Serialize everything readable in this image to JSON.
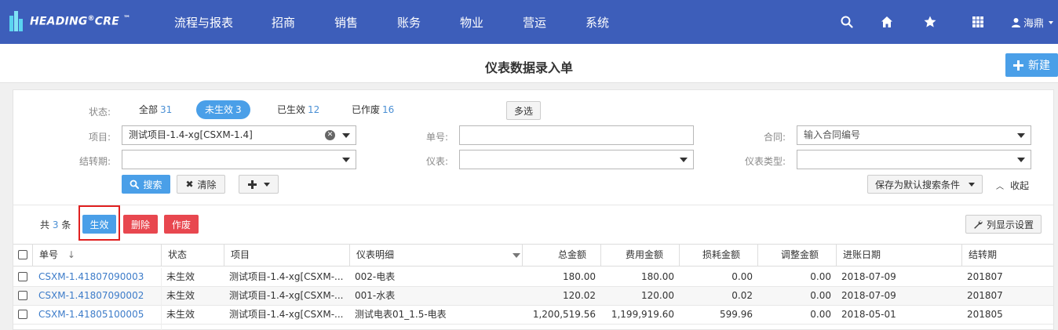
{
  "header": {
    "logo_text": "HEADING",
    "logo_reg": "®",
    "logo_text2": "CRE",
    "logo_tm": "™",
    "nav": [
      "流程与报表",
      "招商",
      "销售",
      "账务",
      "物业",
      "营运",
      "系统"
    ],
    "icons": [
      "search-icon",
      "home-icon",
      "star-icon",
      "grid-icon"
    ],
    "user_name": "海鼎"
  },
  "title_bar": {
    "title": "仪表数据录入单",
    "new_label": "新建"
  },
  "filters": {
    "status_label": "状态:",
    "status_tabs": [
      {
        "label": "全部",
        "count": "31"
      },
      {
        "label": "未生效",
        "count": "3"
      },
      {
        "label": "已生效",
        "count": "12"
      },
      {
        "label": "已作废",
        "count": "16"
      }
    ],
    "multi_select_label": "多选",
    "project_label": "项目:",
    "project_value": "测试项目-1.4-xg[CSXM-1.4]",
    "bill_no_label": "单号:",
    "bill_no_value": "",
    "contract_label": "合同:",
    "contract_placeholder": "输入合同编号",
    "period_label": "结转期:",
    "period_value": "",
    "meter_label": "仪表:",
    "meter_value": "",
    "meter_type_label": "仪表类型:",
    "meter_type_value": "",
    "search_label": "搜索",
    "clear_label": "清除",
    "save_default_label": "保存为默认搜索条件",
    "collapse_label": "收起"
  },
  "actions": {
    "total_prefix": "共",
    "total_count": "3",
    "total_suffix": "条",
    "activate_label": "生效",
    "delete_label": "删除",
    "void_label": "作废",
    "column_settings_label": "列显示设置"
  },
  "table": {
    "columns": [
      "单号",
      "状态",
      "项目",
      "仪表明细",
      "总金额",
      "费用金额",
      "损耗金额",
      "调整金额",
      "进账日期",
      "结转期"
    ],
    "rows": [
      [
        "CSXM-1.41807090003",
        "未生效",
        "测试项目-1.4-xg[CSXM-...",
        "002-电表",
        "180.00",
        "180.00",
        "0.00",
        "0.00",
        "2018-07-09",
        "201807"
      ],
      [
        "CSXM-1.41807090002",
        "未生效",
        "测试项目-1.4-xg[CSXM-...",
        "001-水表",
        "120.02",
        "120.00",
        "0.02",
        "0.00",
        "2018-07-09",
        "201807"
      ],
      [
        "CSXM-1.41805100005",
        "未生效",
        "测试项目-1.4-xg[CSXM-...",
        "测试电表01_1.5-电表",
        "1,200,519.56",
        "1,199,919.60",
        "599.96",
        "0.00",
        "2018-05-01",
        "201805"
      ]
    ]
  },
  "colors": {
    "nav_bg": "#3d5eba",
    "primary": "#4a9fe8",
    "danger": "#e8474f",
    "link": "#3d7cc9",
    "highlight_border": "#e02020"
  }
}
